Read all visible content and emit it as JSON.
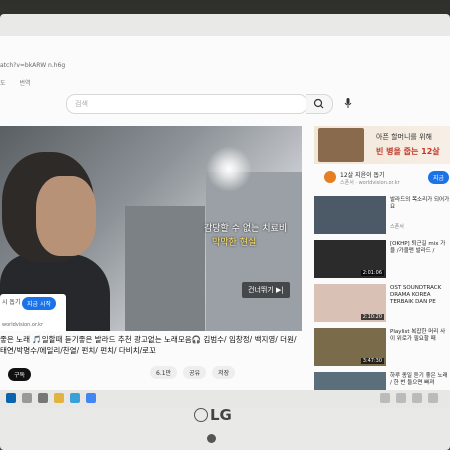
{
  "browser": {
    "url": "atch?v=bkARW n.h6g",
    "bookmarks": [
      "도",
      "번역"
    ]
  },
  "search": {
    "placeholder": "검색"
  },
  "video": {
    "caption_line1": "감당할 수 없는 치료비",
    "caption_line2": "막막한 현실",
    "skip_label": "건너뛰기 ▶|",
    "ad_card": {
      "label": "시 돕기",
      "button": "지금 시작",
      "site": "worldvision.or.kr"
    }
  },
  "title": "좋은 노래 🎵일할때 듣기좋은 발라드 추천 광고없는 노래모음🎧 김범수/ 임창정/ 백지영/ 더원/ 태연/박명수/에일리/찬열/ 펀치/ 펀치/ 다비치/로꼬",
  "channel": {
    "subscribe": "구독"
  },
  "actions": {
    "likes": "6.1만",
    "share": "공유",
    "save": "저장"
  },
  "sidebar": {
    "ad_banner": {
      "line1": "아픈 할머니를 위해",
      "line2": "빈 병을 줍는 12살"
    },
    "ad_info": {
      "line1": "12살 지윤이 돕기",
      "line2": "스폰서 · worldvision.or.kr",
      "button": "지금"
    },
    "recommendations": [
      {
        "title": "발라드의 목소리가 되어가요",
        "meta": "스폰서",
        "duration": ""
      },
      {
        "title": "[OKHP] 퇴근길 mix 가을 /가을맨 발라드 /",
        "meta": "",
        "duration": "2:01:06"
      },
      {
        "title": "OST SOUNDTRACK DRAMA KOREA TERBAIK DAN PE",
        "meta": "",
        "duration": "2:10:20"
      },
      {
        "title": "Playlist 복잡한 머리 사이 위로가 필요할 때",
        "meta": "",
        "duration": "3:47:30"
      },
      {
        "title": "하루 종일 듣기 좋은 노래 / 한 번 들으면 빠져",
        "meta": "",
        "duration": ""
      }
    ]
  },
  "brand": {
    "logo": "LG"
  }
}
